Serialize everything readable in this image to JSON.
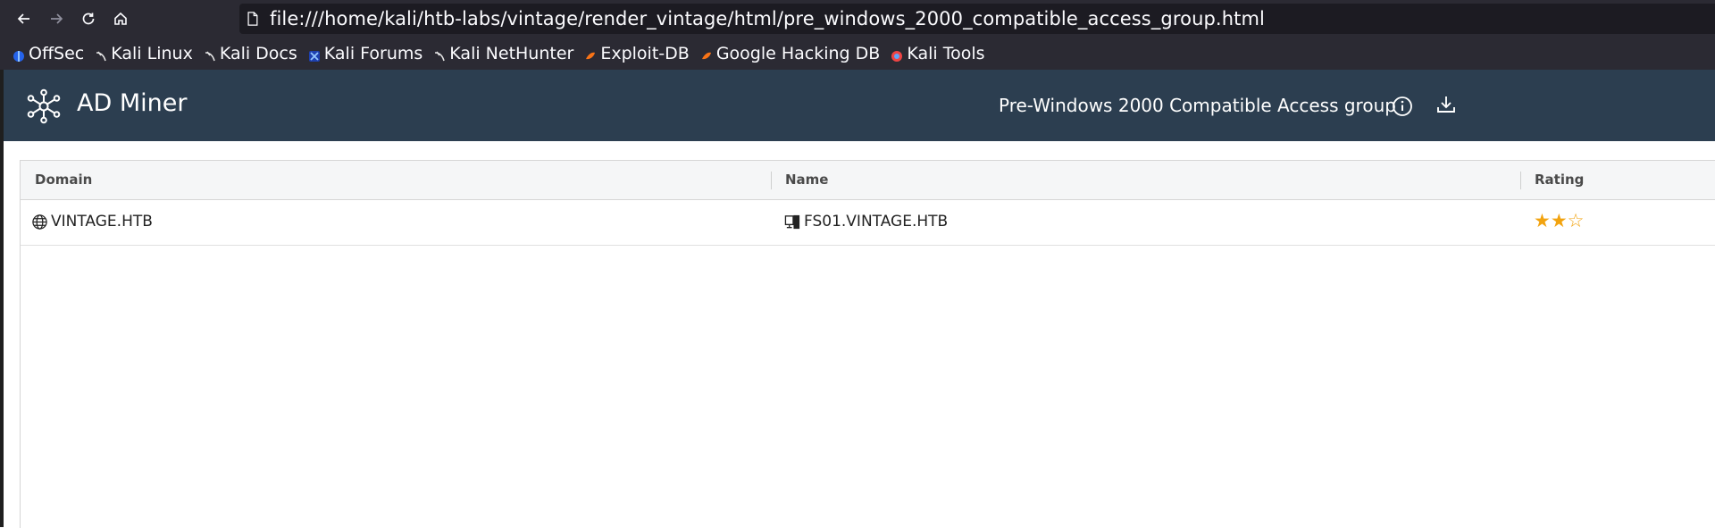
{
  "browser": {
    "url": "file:///home/kali/htb-labs/vintage/render_vintage/html/pre_windows_2000_compatible_access_group.html",
    "bookmarks": [
      {
        "label": "OffSec",
        "icon": "offsec-icon",
        "color": "#3b82f6"
      },
      {
        "label": "Kali Linux",
        "icon": "kali-dragon-icon",
        "color": "#e5e5e5"
      },
      {
        "label": "Kali Docs",
        "icon": "kali-dragon-icon",
        "color": "#e5e5e5"
      },
      {
        "label": "Kali Forums",
        "icon": "kali-forums-icon",
        "color": "#4da3ff"
      },
      {
        "label": "Kali NetHunter",
        "icon": "kali-dragon-icon",
        "color": "#e5e5e5"
      },
      {
        "label": "Exploit-DB",
        "icon": "exploit-db-icon",
        "color": "#f97316"
      },
      {
        "label": "Google Hacking DB",
        "icon": "exploit-db-icon",
        "color": "#f97316"
      },
      {
        "label": "Kali Tools",
        "icon": "kali-tools-icon",
        "color": "#ef4444"
      }
    ]
  },
  "app": {
    "name": "AD Miner",
    "page_title": "Pre-Windows 2000 Compatible Access group",
    "header_color": "#2c3e50"
  },
  "table": {
    "columns": [
      "Domain",
      "Name",
      "Rating"
    ],
    "rows": [
      {
        "domain": "VINTAGE.HTB",
        "name": "FS01.VINTAGE.HTB",
        "rating": 2,
        "rating_max": 3
      }
    ]
  },
  "colors": {
    "star": "#f2a30f"
  }
}
